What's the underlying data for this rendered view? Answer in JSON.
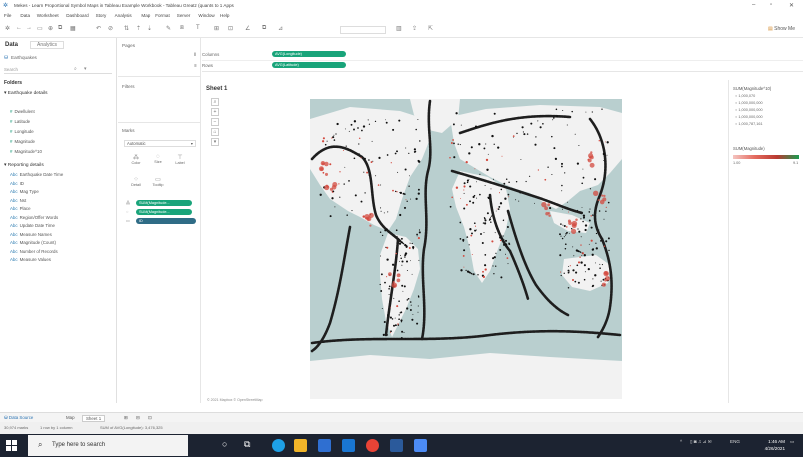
{
  "window": {
    "title": "Mekes - Learn Proportional Symbol Maps in Tableau Example Workbook - Tableau Greatz (quants to 1 Apps"
  },
  "menu": [
    "File",
    "Data",
    "Worksheet",
    "Dashboard",
    "Story",
    "Analysis",
    "Map",
    "Format",
    "Server",
    "Window",
    "Help"
  ],
  "toolbar": {
    "show_me": "Show Me"
  },
  "left_pane": {
    "tab_data": "Data",
    "tab_analytics": "Analytics",
    "datasource": "Earthquakes",
    "search_placeholder": "Search",
    "folders_label": "Folders",
    "groups": [
      {
        "name": "Earthquake details",
        "fields": [
          "Dwellulent",
          "Latitude",
          "Longitude",
          "Magnitude",
          "Magnitude^10"
        ]
      },
      {
        "name": "Reporting details",
        "fields": [
          "Earthquake Date Time",
          "ID",
          "Mag Type",
          "Nst",
          "Place",
          "Region/Offer Words",
          "Update Date Time",
          "Measure Names",
          "Magnitude (Count)",
          "Number of Records",
          "Measure Values"
        ]
      }
    ]
  },
  "mid_pane": {
    "pages_label": "Pages",
    "filters_label": "Filters",
    "marks_label": "Marks",
    "marks_type": "Automatic",
    "mark_buttons": [
      "Color",
      "Size",
      "Label",
      "Detail",
      "Tooltip"
    ],
    "mark_pills": [
      "SUM(Magnitude...",
      "SUM(Magnitude...",
      "ID"
    ]
  },
  "shelves": {
    "columns_label": "Columns",
    "rows_label": "Rows",
    "columns_pill": "AVG(Longitude)",
    "rows_pill": "AVG(Latitude)"
  },
  "sheet": {
    "title": "Sheet 1",
    "copyright": "© 2021 Mapbox © OpenStreetMap"
  },
  "legend": {
    "size_title": "SUM(Magnitude^10)",
    "size_items": [
      "1,000,070",
      "1,000,000,000",
      "1,000,000,000",
      "1,000,000,000",
      "1,000,787,161"
    ],
    "color_title": "SUM(Magnitude)",
    "color_min": "1.00",
    "color_max": "9.1"
  },
  "sheetbar": {
    "data_source": "Data Source",
    "tabs": [
      "Map",
      "Sheet 1"
    ]
  },
  "statusbar": {
    "items": [
      "30,974 marks",
      "1 row by 1 column",
      "SUM of AVG(Longitude): 3,476,325"
    ]
  },
  "taskbar": {
    "search_placeholder": "Type here to search",
    "time": "1:46 AM",
    "date": "4/26/2021",
    "lang": "ENG"
  },
  "colors": {
    "map_water": "#b9cfcf",
    "map_land": "#f4f4f4",
    "quake_red": "#d34a3f",
    "pill_green": "#19a47a",
    "taskbar": "#1c2331"
  }
}
